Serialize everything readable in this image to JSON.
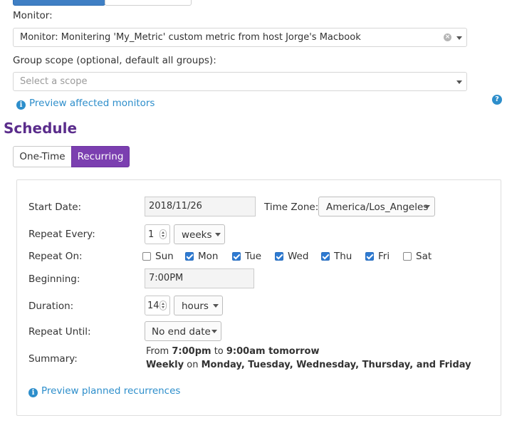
{
  "monitor_section": {
    "monitor_label": "Monitor:",
    "monitor_value": "Monitor: Monitering 'My_Metric' custom metric from host Jorge's Macbook",
    "group_scope_label": "Group scope (optional, default all groups):",
    "group_scope_placeholder": "Select a scope",
    "preview_monitors_link": "Preview affected monitors",
    "help_icon_glyph": "?"
  },
  "schedule": {
    "heading": "Schedule",
    "tabs": [
      "One-Time",
      "Recurring"
    ],
    "active_tab": "Recurring",
    "start_date_label": "Start Date:",
    "start_date_value": "2018/11/26",
    "time_zone_label": "Time Zone:",
    "time_zone_value": "America/Los_Angeles",
    "repeat_every_label": "Repeat Every:",
    "repeat_every_value": "1",
    "repeat_every_unit": "weeks",
    "repeat_on_label": "Repeat On:",
    "days": [
      {
        "label": "Sun",
        "checked": false
      },
      {
        "label": "Mon",
        "checked": true
      },
      {
        "label": "Tue",
        "checked": true
      },
      {
        "label": "Wed",
        "checked": true
      },
      {
        "label": "Thu",
        "checked": true
      },
      {
        "label": "Fri",
        "checked": true
      },
      {
        "label": "Sat",
        "checked": false
      }
    ],
    "beginning_label": "Beginning:",
    "beginning_value": "7:00PM",
    "duration_label": "Duration:",
    "duration_value": "14",
    "duration_unit": "hours",
    "repeat_until_label": "Repeat Until:",
    "repeat_until_value": "No end date",
    "summary_label": "Summary:",
    "summary": {
      "from_word": "From",
      "start_time": "7:00pm",
      "to_word": "to",
      "end_time": "9:00am tomorrow",
      "frequency": "Weekly",
      "on_word": "on",
      "days_text": "Monday, Tuesday, Wednesday, Thursday, and Friday"
    },
    "preview_recurrences_link": "Preview planned recurrences"
  },
  "colors": {
    "accent_purple": "#7b3fb0",
    "heading_purple": "#5b2d8c",
    "link_blue": "#2d8ecb",
    "checkbox_blue": "#2e7ad1"
  },
  "icons": {
    "info": "info-icon",
    "help": "help-icon",
    "clear": "clear-icon",
    "caret": "chevron-down-icon"
  }
}
